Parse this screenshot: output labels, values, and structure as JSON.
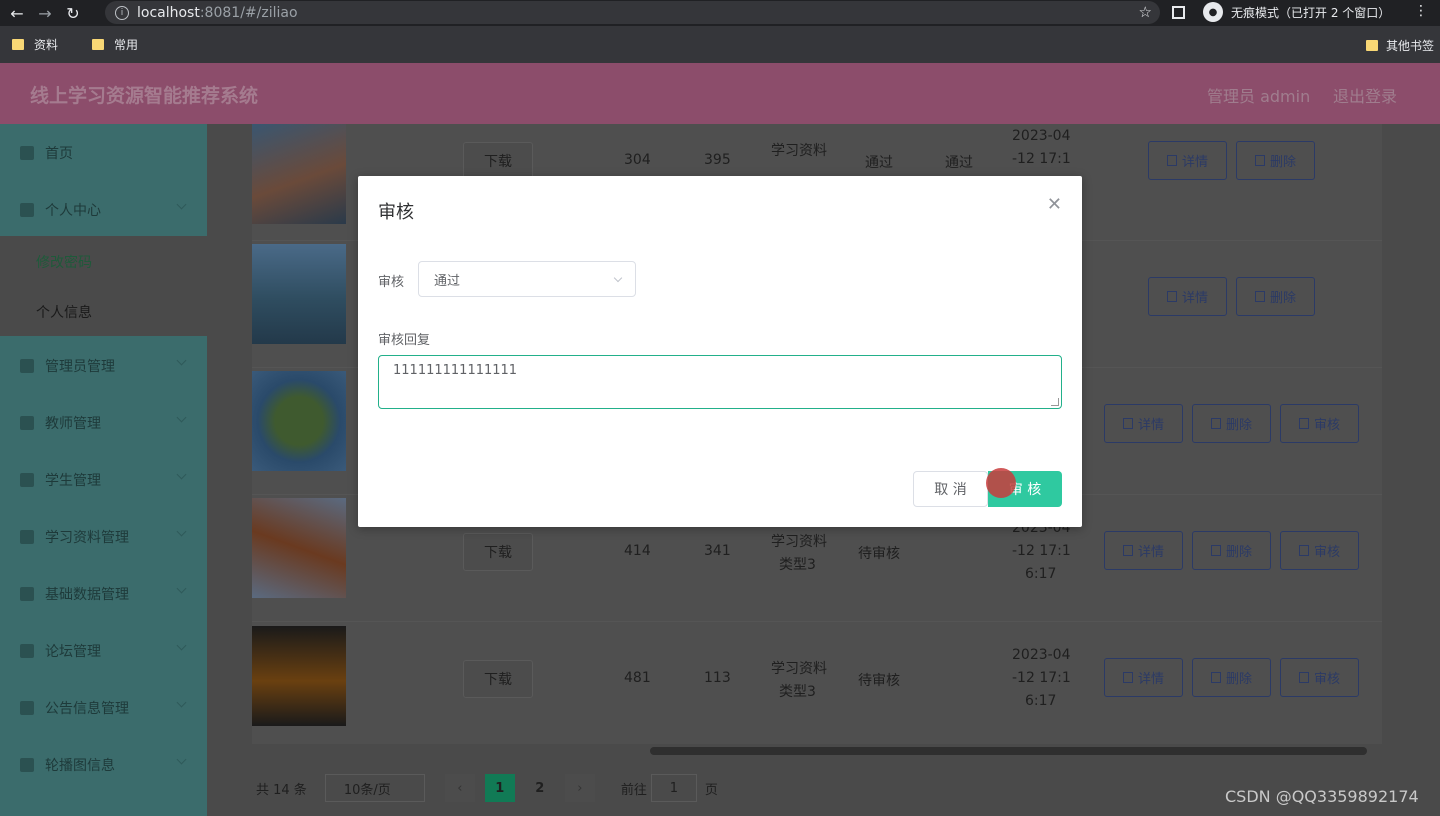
{
  "browser": {
    "url_host": "localhost",
    "url_path": ":8081/#/ziliao",
    "incognito_label": "无痕模式（已打开 2 个窗口）",
    "bookmarks": [
      "资料",
      "常用"
    ],
    "other_bookmarks": "其他书签"
  },
  "header": {
    "title": "线上学习资源智能推荐系统",
    "user": "管理员 admin",
    "logout": "退出登录"
  },
  "sidebar": {
    "items": [
      {
        "label": "首页"
      },
      {
        "label": "个人中心"
      },
      {
        "label": "管理员管理"
      },
      {
        "label": "教师管理"
      },
      {
        "label": "学生管理"
      },
      {
        "label": "学习资料管理"
      },
      {
        "label": "基础数据管理"
      },
      {
        "label": "论坛管理"
      },
      {
        "label": "公告信息管理"
      },
      {
        "label": "轮播图信息"
      }
    ],
    "sub_items": [
      "修改密码",
      "个人信息"
    ]
  },
  "table": {
    "rows": [
      {
        "download": "下载",
        "a": "304",
        "b": "395",
        "type": "学习资料",
        "s1": "通过",
        "s2": "通过",
        "date": "2023-04",
        "date2": "-12 17:1",
        "date3": ""
      },
      {
        "download": "",
        "a": "",
        "b": "",
        "type": "",
        "s1": "",
        "s2": "",
        "date": "",
        "date2": "",
        "date3": ""
      },
      {
        "download": "",
        "a": "",
        "b": "",
        "type": "",
        "s1": "",
        "s2": "",
        "date": "",
        "date2": "",
        "date3": ""
      },
      {
        "download": "下载",
        "a": "414",
        "b": "341",
        "type": "学习资料",
        "type2": "类型3",
        "s1": "待审核",
        "date": "2023-04",
        "date2": "-12 17:1",
        "date3": "6:17"
      },
      {
        "download": "下载",
        "a": "481",
        "b": "113",
        "type": "学习资料",
        "type2": "类型3",
        "s1": "待审核",
        "date": "2023-04",
        "date2": "-12 17:1",
        "date3": "6:17"
      }
    ],
    "actions": {
      "detail": "详情",
      "delete": "删除",
      "review": "审核"
    }
  },
  "pager": {
    "total": "共 14 条",
    "size": "10条/页",
    "pages": [
      "1",
      "2"
    ],
    "goto": "前往",
    "goto_value": "1",
    "page_unit": "页"
  },
  "dialog": {
    "title": "审核",
    "field_status_label": "审核",
    "status_value": "通过",
    "field_reply_label": "审核回复",
    "reply_value": "111111111111111",
    "cancel": "取 消",
    "confirm": "审 核"
  },
  "watermark": "CSDN @QQ3359892174"
}
